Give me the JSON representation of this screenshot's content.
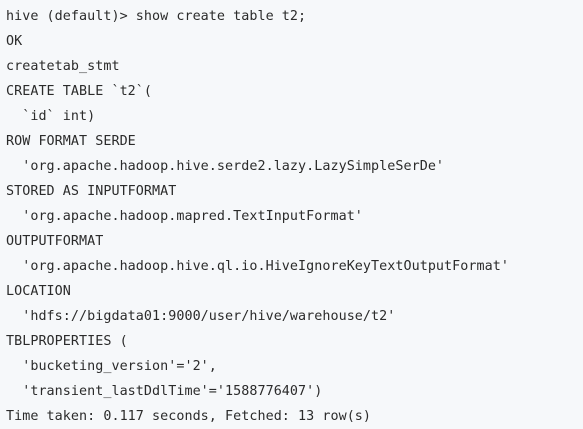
{
  "terminal": {
    "lines": [
      "hive (default)> show create table t2;",
      "OK",
      "createtab_stmt",
      "CREATE TABLE `t2`(",
      "  `id` int)",
      "ROW FORMAT SERDE",
      "  'org.apache.hadoop.hive.serde2.lazy.LazySimpleSerDe'",
      "STORED AS INPUTFORMAT",
      "  'org.apache.hadoop.mapred.TextInputFormat'",
      "OUTPUTFORMAT",
      "  'org.apache.hadoop.hive.ql.io.HiveIgnoreKeyTextOutputFormat'",
      "LOCATION",
      "  'hdfs://bigdata01:9000/user/hive/warehouse/t2'",
      "TBLPROPERTIES (",
      "  'bucketing_version'='2',",
      "  'transient_lastDdlTime'='1588776407')",
      "Time taken: 0.117 seconds, Fetched: 13 row(s)"
    ]
  }
}
